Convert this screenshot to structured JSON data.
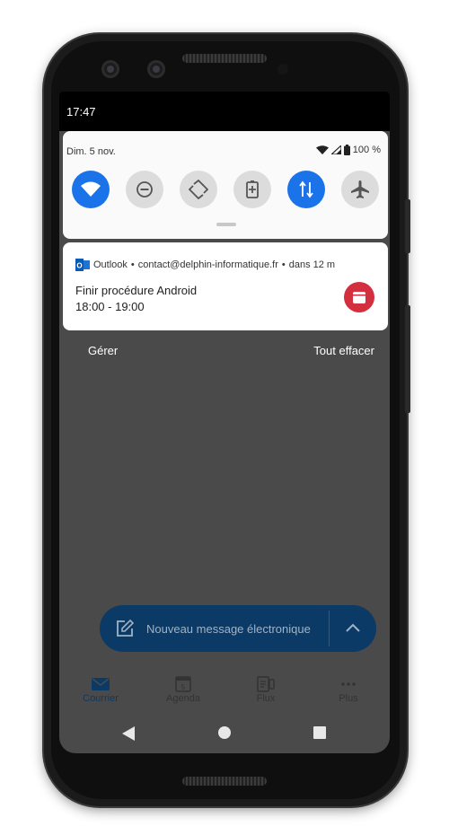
{
  "status_bar": {
    "time": "17:47"
  },
  "quick_settings": {
    "date": "Dim. 5 nov.",
    "battery_text": "100 %",
    "tiles": [
      {
        "name": "wifi",
        "icon": "wifi-icon",
        "active": true
      },
      {
        "name": "do-not-disturb",
        "icon": "do-not-disturb-icon",
        "active": false
      },
      {
        "name": "auto-rotate",
        "icon": "auto-rotate-icon",
        "active": false
      },
      {
        "name": "battery-saver",
        "icon": "battery-saver-icon",
        "active": false
      },
      {
        "name": "mobile-data",
        "icon": "mobile-data-icon",
        "active": true
      },
      {
        "name": "airplane-mode",
        "icon": "airplane-icon",
        "active": false
      }
    ]
  },
  "notification": {
    "app": "Outlook",
    "account": "contact@delphin-informatique.fr",
    "when": "dans 12 m",
    "separator": "•",
    "title": "Finir procédure Android",
    "time_range": "18:00 - 19:00"
  },
  "shade_actions": {
    "manage": "Gérer",
    "clear_all": "Tout effacer"
  },
  "compose_fab": {
    "label": "Nouveau message électronique"
  },
  "bottom_nav": {
    "items": [
      {
        "label": "Courrier",
        "icon": "mail-icon",
        "active": true
      },
      {
        "label": "Agenda",
        "icon": "calendar-icon",
        "active": false,
        "badge": "5"
      },
      {
        "label": "Flux",
        "icon": "feed-icon",
        "active": false
      },
      {
        "label": "Plus",
        "icon": "more-icon",
        "active": false
      }
    ]
  },
  "colors": {
    "accent_blue": "#1a73e8",
    "calendar_red": "#d32f3f",
    "scrim": "#4a4a4a",
    "fab_background": "#0b3a66"
  }
}
